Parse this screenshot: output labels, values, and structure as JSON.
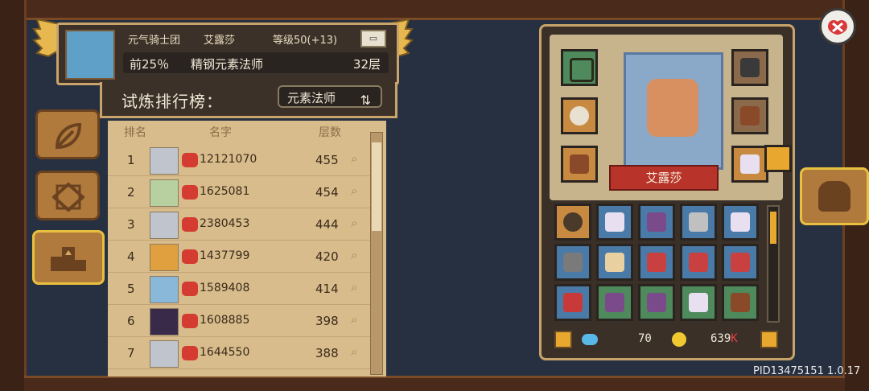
{
  "profile": {
    "guild": "元气骑士团",
    "name": "艾露莎",
    "level": "等级50(+13)",
    "percent": "前25％",
    "class_title": "精钢元素法师",
    "floor": "32层"
  },
  "ranking": {
    "title": "试炼排行榜：",
    "class_filter": "元素法师",
    "headers": {
      "rank": "排名",
      "name": "名字",
      "layers": "层数"
    },
    "rows": [
      {
        "rank": "1",
        "id": "12121070",
        "score": "455"
      },
      {
        "rank": "2",
        "id": "1625081",
        "score": "454"
      },
      {
        "rank": "3",
        "id": "2380453",
        "score": "444"
      },
      {
        "rank": "4",
        "id": "1437799",
        "score": "420"
      },
      {
        "rank": "5",
        "id": "1589408",
        "score": "414"
      },
      {
        "rank": "6",
        "id": "1608885",
        "score": "398"
      },
      {
        "rank": "7",
        "id": "1644550",
        "score": "388"
      }
    ]
  },
  "equipment": {
    "character_name": "艾露莎",
    "gems": "70",
    "coins": "639",
    "coins_suffix": "K"
  },
  "footer": {
    "pid": "PID13475151 1.0.17"
  },
  "colors": {
    "accent": "#c8a46a",
    "gold": "#e8a830",
    "red": "#b8342a"
  },
  "icons": [
    "leaf-icon",
    "diamond-icon",
    "podium-icon",
    "helmet-icon",
    "close-icon",
    "swap-icon",
    "search-icon"
  ]
}
